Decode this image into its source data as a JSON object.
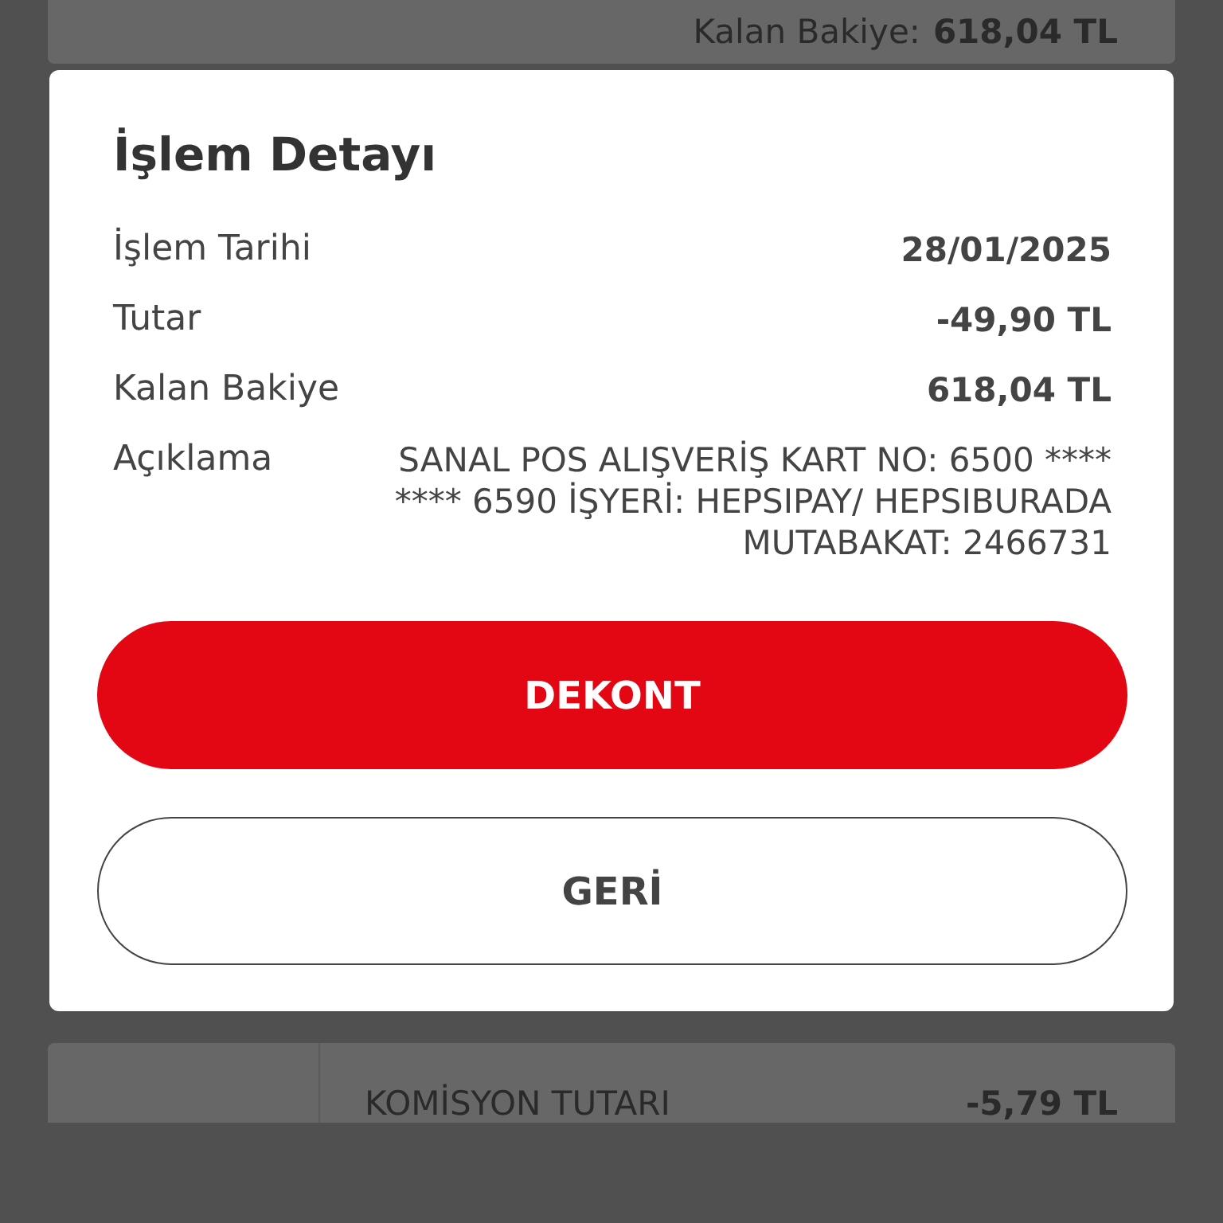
{
  "background_top": {
    "label": "Kalan Bakiye:",
    "value": "618,04 TL"
  },
  "dialog": {
    "title": "İşlem Detayı",
    "rows": [
      {
        "label": "İşlem Tarihi",
        "value": "28/01/2025"
      },
      {
        "label": "Tutar",
        "value": "-49,90 TL"
      },
      {
        "label": "Kalan Bakiye",
        "value": "618,04 TL"
      },
      {
        "label": "Açıklama",
        "value": "SANAL POS ALIŞVERİŞ KART NO: 6500 **** **** 6590 İŞYERİ: HEPSIPAY/ HEPSIBURADA MUTABAKAT: 2466731"
      }
    ],
    "buttons": [
      {
        "label": "DEKONT",
        "kind": "primary"
      },
      {
        "label": "GERİ",
        "kind": "secondary"
      }
    ]
  },
  "background_bottom": {
    "label": "KOMİSYON TUTARI",
    "value": "-5,79 TL"
  }
}
